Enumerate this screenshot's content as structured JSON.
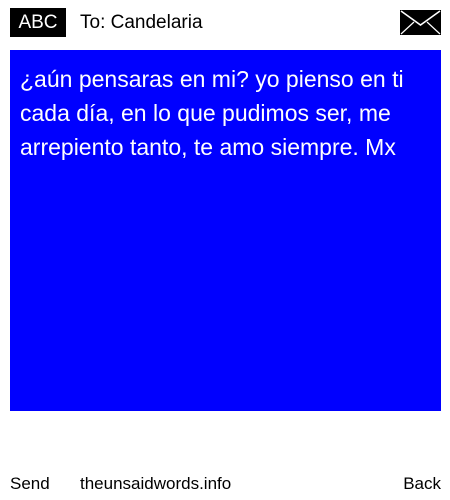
{
  "header": {
    "input_mode": "ABC",
    "to_label": "To: Candelaria",
    "icon": "envelope-icon"
  },
  "message": {
    "text": "¿aún pensaras en mi? yo pienso en ti cada día, en lo que pudimos ser, me arrepiento tanto, te amo siempre. Mx",
    "background_color": "#0000ff",
    "text_color": "#ffffff"
  },
  "footer": {
    "left_softkey": "Send",
    "site": "theunsaidwords.info",
    "right_softkey": "Back"
  }
}
